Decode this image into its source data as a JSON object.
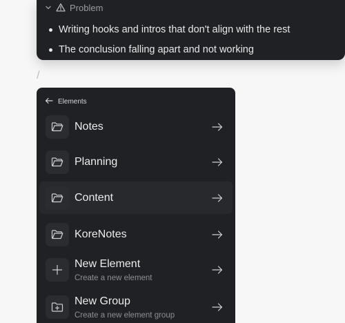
{
  "problem_card": {
    "title": "Problem",
    "bullets": [
      "Writing hooks and intros that don't align with the rest",
      "The conclusion falling apart and not working"
    ]
  },
  "slash_text": "/",
  "elements_panel": {
    "back_label": "Elements",
    "items": [
      {
        "label": "Notes",
        "icon": "folder-icon"
      },
      {
        "label": "Planning",
        "icon": "folder-icon"
      },
      {
        "label": "Content",
        "icon": "folder-icon",
        "active": true
      },
      {
        "label": "KoreNotes",
        "icon": "folder-icon"
      },
      {
        "label": "New Element",
        "sub": "Create a new element",
        "icon": "plus-icon"
      },
      {
        "label": "New Group",
        "sub": "Create a new element group",
        "icon": "folder-plus-icon"
      }
    ]
  },
  "colors": {
    "page_bg": "#f7f7f8",
    "panel_bg": "#202124",
    "active_row_bg": "#28292d",
    "text_primary": "#ececee",
    "text_muted": "#8e8f95"
  }
}
